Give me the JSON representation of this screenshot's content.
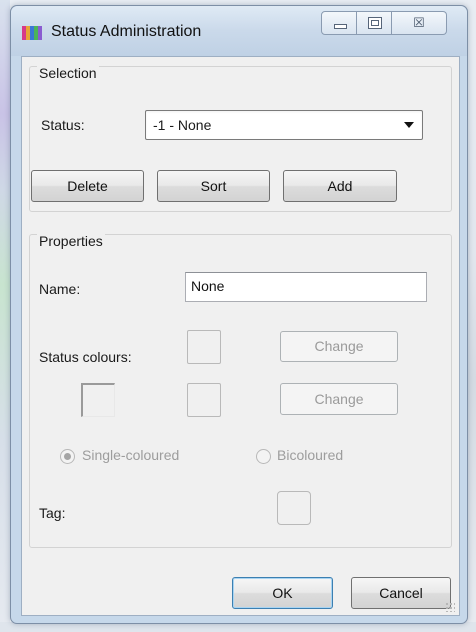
{
  "window": {
    "title": "Status Administration",
    "icon_name": "status-app-icon",
    "caption_buttons": {
      "minimize_icon": "minimize-icon",
      "maximize_icon": "maximize-icon",
      "close_glyph": "☒"
    }
  },
  "selection": {
    "group_label": "Selection",
    "status_label": "Status:",
    "status_value": "-1 - None",
    "buttons": {
      "delete": "Delete",
      "sort": "Sort",
      "add": "Add"
    }
  },
  "properties": {
    "group_label": "Properties",
    "name_label": "Name:",
    "name_value": "None",
    "status_colours_label": "Status colours:",
    "change_1": "Change",
    "change_2": "Change",
    "single_coloured_label": "Single-coloured",
    "single_coloured_checked": true,
    "bicoloured_label": "Bicoloured",
    "bicoloured_checked": false,
    "tag_label": "Tag:"
  },
  "footer": {
    "ok": "OK",
    "cancel": "Cancel"
  },
  "colors": {
    "titlebar": "#c6d8ea",
    "client_bg": "#f0f0f0",
    "disabled_text": "#9d9d9d",
    "default_button_border": "#3c7fb1"
  }
}
